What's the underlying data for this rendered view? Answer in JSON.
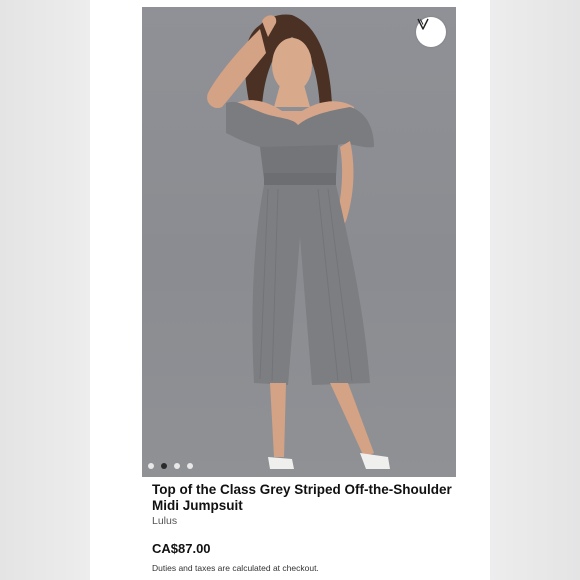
{
  "product": {
    "title": "Top of the Class Grey Striped Off-the-Shoulder Midi Jumpsuit",
    "brand": "Lulus",
    "price": "CA$87.00",
    "tax_note": "Duties and taxes are calculated at checkout."
  },
  "gallery": {
    "dot_count": 4,
    "active_index": 1,
    "favorite_icon": "heart-v-icon"
  },
  "colors": {
    "photo_bg": "#8f9196",
    "jumpsuit": "#77797c",
    "card": "#ffffff"
  }
}
